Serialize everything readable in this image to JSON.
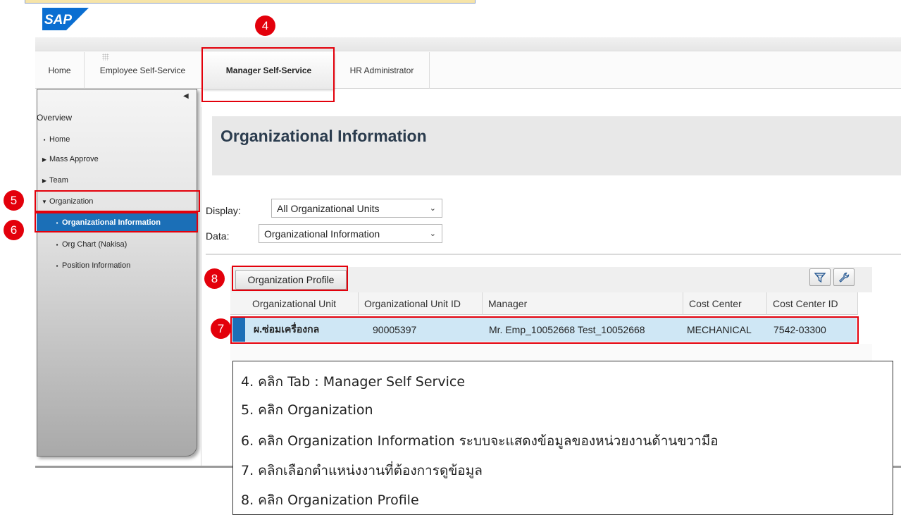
{
  "header": {
    "logo_text": "SAP",
    "brand_color": "#0a6ed1"
  },
  "tabs": [
    {
      "label": "Home"
    },
    {
      "label": "Employee Self-Service"
    },
    {
      "label": "Manager Self-Service",
      "active": true
    },
    {
      "label": "HR Administrator"
    }
  ],
  "sidebar": {
    "collapse_icon": "triangle-left-icon",
    "title": "Overview",
    "items": [
      {
        "label": "Home",
        "marker": "bullet"
      },
      {
        "label": "Mass Approve",
        "marker": "expand-arrow"
      },
      {
        "label": "Team",
        "marker": "expand-arrow"
      },
      {
        "label": "Organization",
        "marker": "collapse-arrow"
      },
      {
        "label": "Organizational Information",
        "marker": "bullet",
        "selected": true
      },
      {
        "label": "Org Chart (Nakisa)",
        "marker": "bullet"
      },
      {
        "label": "Position Information",
        "marker": "bullet"
      }
    ],
    "selected_color": "#1b6fb7"
  },
  "main": {
    "title": "Organizational Information",
    "display_label": "Display:",
    "display_value": "All Organizational Units",
    "data_label": "Data:",
    "data_value": "Organizational Information"
  },
  "grid": {
    "profile_button": "Organization Profile",
    "filter_icon": "filter-icon",
    "settings_icon": "wrench-icon",
    "columns": [
      "Organizational Unit",
      "Organizational Unit ID",
      "Manager",
      "Cost Center",
      "Cost Center ID"
    ],
    "rows": [
      [
        "ผ.ซ่อมเครื่องกล",
        "90005397",
        "Mr. Emp_10052668 Test_10052668",
        "MECHANICAL",
        "7542-03300"
      ]
    ],
    "row_highlight": "#cfe7f5"
  },
  "callouts": {
    "color": "#e3000b",
    "labels": [
      "4",
      "5",
      "6",
      "7",
      "8"
    ]
  },
  "notes": [
    "4. คลิก Tab :  Manager Self Service",
    "5. คลิก Organization",
    "6. คลิก Organization Information  ระบบจะแสดงข้อมูลของหน่วยงานด้านขวามือ",
    "7. คลิกเลือกตำแหน่งงานที่ต้องการดูข้อมูล",
    "8. คลิก Organization Profile"
  ]
}
